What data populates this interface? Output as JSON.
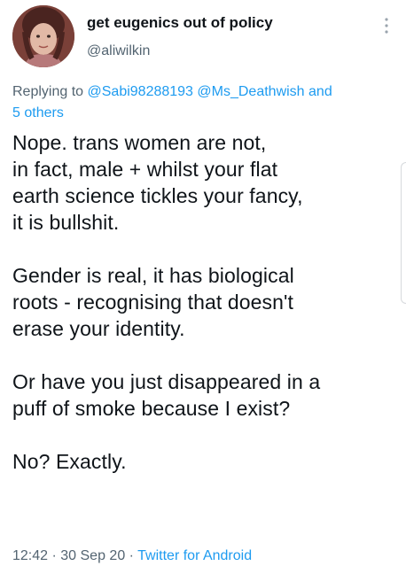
{
  "author": {
    "display_name": "get eugenics out of policy",
    "handle": "@aliwilkin",
    "avatar_icon": "profile-photo"
  },
  "reply": {
    "prefix": "Replying to ",
    "mentions": "@Sabi98288193 @Ms_Deathwish and",
    "others": "5 others"
  },
  "tweet": {
    "text": "Nope. trans women are not,\nin fact, male + whilst your flat\nearth science tickles your fancy,\nit is bullshit.\n\nGender is real, it has biological\nroots - recognising that doesn't\nerase your identity.\n\nOr have you just disappeared in a\npuff of smoke because I exist?\n\nNo? Exactly."
  },
  "meta": {
    "time": "12:42",
    "separator1": " · ",
    "date": "30 Sep 20",
    "separator2": " · ",
    "source": "Twitter for Android"
  },
  "colors": {
    "link": "#1d9bf0",
    "secondary_text": "#536471",
    "primary_text": "#0f1419"
  },
  "icons": {
    "more": "more-vertical-icon"
  }
}
